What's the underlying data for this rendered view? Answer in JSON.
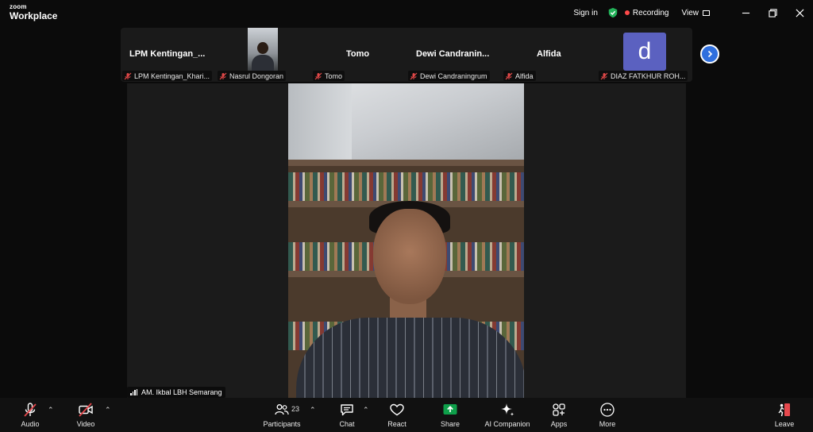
{
  "app": {
    "brand_small": "zoom",
    "brand_big": "Workplace"
  },
  "topbar": {
    "sign_in": "Sign in",
    "recording": "Recording",
    "view": "View"
  },
  "strip": {
    "tiles": [
      {
        "big_name": "LPM  Kentingan_...",
        "tag": "LPM Kentingan_Khari..."
      },
      {
        "big_name": "",
        "tag": "Nasrul Dongoran"
      },
      {
        "big_name": "Tomo",
        "tag": "Tomo"
      },
      {
        "big_name": "Dewi  Candranin...",
        "tag": "Dewi Candraningrum"
      },
      {
        "big_name": "Alfida",
        "tag": "Alfida"
      },
      {
        "big_name": "",
        "tag": "DIAZ FATKHUR ROH...",
        "avatar_letter": "d"
      }
    ]
  },
  "speaker": {
    "name": "AM. Ikbal LBH Semarang"
  },
  "toolbar": {
    "audio": "Audio",
    "video": "Video",
    "participants": "Participants",
    "participants_count": "23",
    "chat": "Chat",
    "react": "React",
    "share": "Share",
    "ai_companion": "AI Companion",
    "apps": "Apps",
    "more": "More",
    "leave": "Leave"
  },
  "colors": {
    "share_green": "#0e9f4a",
    "leave_red": "#e5484d",
    "avatar_purple": "#5b61c0",
    "accent_blue": "#2f6fde"
  }
}
